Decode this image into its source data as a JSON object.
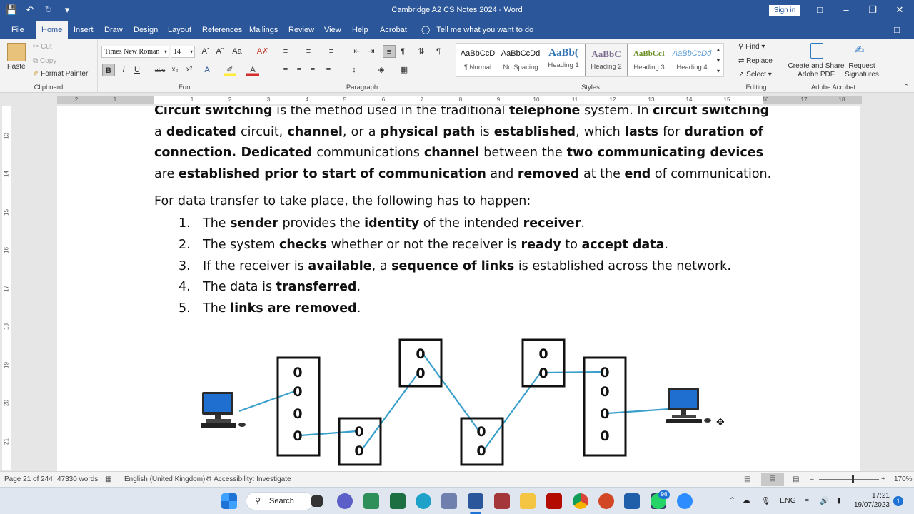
{
  "titlebar": {
    "title": "Cambridge A2 CS Notes 2024  -  Word",
    "signin": "Sign in"
  },
  "tabs": [
    "File",
    "Home",
    "Insert",
    "Draw",
    "Design",
    "Layout",
    "References",
    "Mailings",
    "Review",
    "View",
    "Help",
    "Acrobat"
  ],
  "tellme": "Tell me what you want to do",
  "ribbon": {
    "clipboard": {
      "paste": "Paste",
      "cut": "Cut",
      "copy": "Copy",
      "format_painter": "Format Painter",
      "label": "Clipboard"
    },
    "font": {
      "name": "Times New Roman",
      "size": "14",
      "label": "Font"
    },
    "paragraph": {
      "label": "Paragraph"
    },
    "styles": {
      "label": "Styles",
      "items": [
        {
          "preview": "AaBbCcD",
          "name": "¶ Normal"
        },
        {
          "preview": "AaBbCcDd",
          "name": "No Spacing"
        },
        {
          "preview": "AaBb(",
          "name": "Heading 1"
        },
        {
          "preview": "AaBbC",
          "name": "Heading 2"
        },
        {
          "preview": "AaBbCcI",
          "name": "Heading 3"
        },
        {
          "preview": "AaBbCcDd",
          "name": "Heading 4"
        }
      ]
    },
    "editing": {
      "find": "Find",
      "replace": "Replace",
      "select": "Select",
      "label": "Editing"
    },
    "acrobat": {
      "create": "Create and Share Adobe PDF",
      "request": "Request Signatures",
      "label": "Adobe Acrobat"
    }
  },
  "ruler": {
    "numbers": [
      "2",
      "1",
      "1",
      "2",
      "3",
      "4",
      "5",
      "6",
      "7",
      "8",
      "9",
      "10",
      "11",
      "12",
      "13",
      "14",
      "15",
      "16",
      "17",
      "18"
    ]
  },
  "vruler": {
    "numbers": [
      "13",
      "14",
      "15",
      "16",
      "17",
      "18",
      "19",
      "20",
      "21"
    ]
  },
  "document": {
    "para1_lines": [
      [
        {
          "t": "Circuit switching",
          "b": true
        },
        {
          "t": " is the method used in the traditional "
        },
        {
          "t": "telephone",
          "b": true
        },
        {
          "t": " system. In "
        },
        {
          "t": "circuit switching",
          "b": true
        }
      ],
      [
        {
          "t": "a "
        },
        {
          "t": "dedicated",
          "b": true
        },
        {
          "t": " circuit, "
        },
        {
          "t": "channel",
          "b": true
        },
        {
          "t": ", or a "
        },
        {
          "t": "physical path",
          "b": true
        },
        {
          "t": " is "
        },
        {
          "t": "established",
          "b": true
        },
        {
          "t": ", which "
        },
        {
          "t": "lasts",
          "b": true
        },
        {
          "t": " for "
        },
        {
          "t": "duration of",
          "b": true
        }
      ],
      [
        {
          "t": "connection. Dedicated",
          "b": true
        },
        {
          "t": " communications "
        },
        {
          "t": "channel",
          "b": true
        },
        {
          "t": " between the "
        },
        {
          "t": "two communicating devices",
          "b": true
        }
      ],
      [
        {
          "t": "are "
        },
        {
          "t": "established prior to start of communication",
          "b": true
        },
        {
          "t": " and "
        },
        {
          "t": "removed",
          "b": true
        },
        {
          "t": " at the "
        },
        {
          "t": "end",
          "b": true
        },
        {
          "t": " of communication."
        }
      ]
    ],
    "para2": "For data transfer to take place, the following has to happen:",
    "list": [
      {
        "num": "1.",
        "parts": [
          {
            "t": "The "
          },
          {
            "t": "sender",
            "b": true
          },
          {
            "t": " provides the "
          },
          {
            "t": "identity",
            "b": true
          },
          {
            "t": " of the intended "
          },
          {
            "t": "receiver",
            "b": true
          },
          {
            "t": "."
          }
        ]
      },
      {
        "num": "2.",
        "parts": [
          {
            "t": "The system "
          },
          {
            "t": "checks",
            "b": true
          },
          {
            "t": " whether or not the receiver is "
          },
          {
            "t": "ready",
            "b": true
          },
          {
            "t": " to "
          },
          {
            "t": "accept data",
            "b": true
          },
          {
            "t": "."
          }
        ]
      },
      {
        "num": "3.",
        "parts": [
          {
            "t": "If the receiver is "
          },
          {
            "t": "available",
            "b": true
          },
          {
            "t": ", a "
          },
          {
            "t": "sequence of links",
            "b": true
          },
          {
            "t": " is established across the network."
          }
        ]
      },
      {
        "num": "4.",
        "parts": [
          {
            "t": "The data is "
          },
          {
            "t": "transferred",
            "b": true
          },
          {
            "t": "."
          }
        ]
      },
      {
        "num": "5.",
        "parts": [
          {
            "t": "The "
          },
          {
            "t": "links are removed",
            "b": true
          },
          {
            "t": "."
          }
        ]
      }
    ],
    "diagram_node_label": "0"
  },
  "statusbar": {
    "page": "Page 21 of 244",
    "words": "47330 words",
    "language": "English (United Kingdom)",
    "accessibility": "Accessibility: Investigate",
    "zoom": "170%"
  },
  "taskbar": {
    "search": "Search",
    "lang": "ENG",
    "time": "17:21",
    "date": "19/07/2023",
    "badge": "96",
    "notif": "1"
  },
  "colors": {
    "word_blue": "#2b579a",
    "link_line": "#3a9fcb"
  }
}
